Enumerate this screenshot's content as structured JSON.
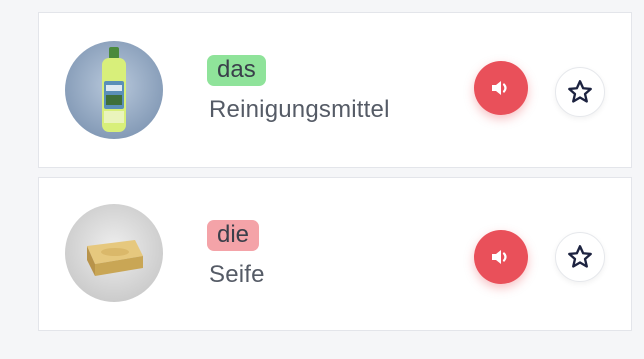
{
  "colors": {
    "article_das": "#8fe39a",
    "article_die": "#f4a3a8",
    "audio_button": "#e9505a",
    "star_outline": "#1d2340"
  },
  "items": [
    {
      "article": "das",
      "noun": "Reinigungsmittel",
      "image": "cleaning-bottle-image",
      "audio_icon": "speaker-icon",
      "favorite_icon": "star-icon"
    },
    {
      "article": "die",
      "noun": "Seife",
      "image": "soap-bar-image",
      "audio_icon": "speaker-icon",
      "favorite_icon": "star-icon"
    }
  ]
}
